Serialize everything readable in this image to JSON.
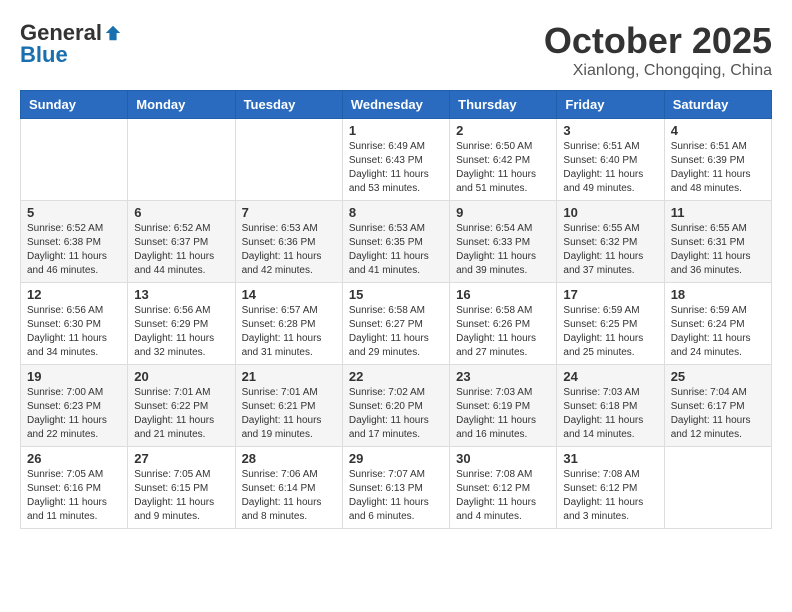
{
  "header": {
    "logo_general": "General",
    "logo_blue": "Blue",
    "month_title": "October 2025",
    "location": "Xianlong, Chongqing, China"
  },
  "weekdays": [
    "Sunday",
    "Monday",
    "Tuesday",
    "Wednesday",
    "Thursday",
    "Friday",
    "Saturday"
  ],
  "weeks": [
    [
      {
        "day": "",
        "info": ""
      },
      {
        "day": "",
        "info": ""
      },
      {
        "day": "",
        "info": ""
      },
      {
        "day": "1",
        "info": "Sunrise: 6:49 AM\nSunset: 6:43 PM\nDaylight: 11 hours\nand 53 minutes."
      },
      {
        "day": "2",
        "info": "Sunrise: 6:50 AM\nSunset: 6:42 PM\nDaylight: 11 hours\nand 51 minutes."
      },
      {
        "day": "3",
        "info": "Sunrise: 6:51 AM\nSunset: 6:40 PM\nDaylight: 11 hours\nand 49 minutes."
      },
      {
        "day": "4",
        "info": "Sunrise: 6:51 AM\nSunset: 6:39 PM\nDaylight: 11 hours\nand 48 minutes."
      }
    ],
    [
      {
        "day": "5",
        "info": "Sunrise: 6:52 AM\nSunset: 6:38 PM\nDaylight: 11 hours\nand 46 minutes."
      },
      {
        "day": "6",
        "info": "Sunrise: 6:52 AM\nSunset: 6:37 PM\nDaylight: 11 hours\nand 44 minutes."
      },
      {
        "day": "7",
        "info": "Sunrise: 6:53 AM\nSunset: 6:36 PM\nDaylight: 11 hours\nand 42 minutes."
      },
      {
        "day": "8",
        "info": "Sunrise: 6:53 AM\nSunset: 6:35 PM\nDaylight: 11 hours\nand 41 minutes."
      },
      {
        "day": "9",
        "info": "Sunrise: 6:54 AM\nSunset: 6:33 PM\nDaylight: 11 hours\nand 39 minutes."
      },
      {
        "day": "10",
        "info": "Sunrise: 6:55 AM\nSunset: 6:32 PM\nDaylight: 11 hours\nand 37 minutes."
      },
      {
        "day": "11",
        "info": "Sunrise: 6:55 AM\nSunset: 6:31 PM\nDaylight: 11 hours\nand 36 minutes."
      }
    ],
    [
      {
        "day": "12",
        "info": "Sunrise: 6:56 AM\nSunset: 6:30 PM\nDaylight: 11 hours\nand 34 minutes."
      },
      {
        "day": "13",
        "info": "Sunrise: 6:56 AM\nSunset: 6:29 PM\nDaylight: 11 hours\nand 32 minutes."
      },
      {
        "day": "14",
        "info": "Sunrise: 6:57 AM\nSunset: 6:28 PM\nDaylight: 11 hours\nand 31 minutes."
      },
      {
        "day": "15",
        "info": "Sunrise: 6:58 AM\nSunset: 6:27 PM\nDaylight: 11 hours\nand 29 minutes."
      },
      {
        "day": "16",
        "info": "Sunrise: 6:58 AM\nSunset: 6:26 PM\nDaylight: 11 hours\nand 27 minutes."
      },
      {
        "day": "17",
        "info": "Sunrise: 6:59 AM\nSunset: 6:25 PM\nDaylight: 11 hours\nand 25 minutes."
      },
      {
        "day": "18",
        "info": "Sunrise: 6:59 AM\nSunset: 6:24 PM\nDaylight: 11 hours\nand 24 minutes."
      }
    ],
    [
      {
        "day": "19",
        "info": "Sunrise: 7:00 AM\nSunset: 6:23 PM\nDaylight: 11 hours\nand 22 minutes."
      },
      {
        "day": "20",
        "info": "Sunrise: 7:01 AM\nSunset: 6:22 PM\nDaylight: 11 hours\nand 21 minutes."
      },
      {
        "day": "21",
        "info": "Sunrise: 7:01 AM\nSunset: 6:21 PM\nDaylight: 11 hours\nand 19 minutes."
      },
      {
        "day": "22",
        "info": "Sunrise: 7:02 AM\nSunset: 6:20 PM\nDaylight: 11 hours\nand 17 minutes."
      },
      {
        "day": "23",
        "info": "Sunrise: 7:03 AM\nSunset: 6:19 PM\nDaylight: 11 hours\nand 16 minutes."
      },
      {
        "day": "24",
        "info": "Sunrise: 7:03 AM\nSunset: 6:18 PM\nDaylight: 11 hours\nand 14 minutes."
      },
      {
        "day": "25",
        "info": "Sunrise: 7:04 AM\nSunset: 6:17 PM\nDaylight: 11 hours\nand 12 minutes."
      }
    ],
    [
      {
        "day": "26",
        "info": "Sunrise: 7:05 AM\nSunset: 6:16 PM\nDaylight: 11 hours\nand 11 minutes."
      },
      {
        "day": "27",
        "info": "Sunrise: 7:05 AM\nSunset: 6:15 PM\nDaylight: 11 hours\nand 9 minutes."
      },
      {
        "day": "28",
        "info": "Sunrise: 7:06 AM\nSunset: 6:14 PM\nDaylight: 11 hours\nand 8 minutes."
      },
      {
        "day": "29",
        "info": "Sunrise: 7:07 AM\nSunset: 6:13 PM\nDaylight: 11 hours\nand 6 minutes."
      },
      {
        "day": "30",
        "info": "Sunrise: 7:08 AM\nSunset: 6:12 PM\nDaylight: 11 hours\nand 4 minutes."
      },
      {
        "day": "31",
        "info": "Sunrise: 7:08 AM\nSunset: 6:12 PM\nDaylight: 11 hours\nand 3 minutes."
      },
      {
        "day": "",
        "info": ""
      }
    ]
  ]
}
